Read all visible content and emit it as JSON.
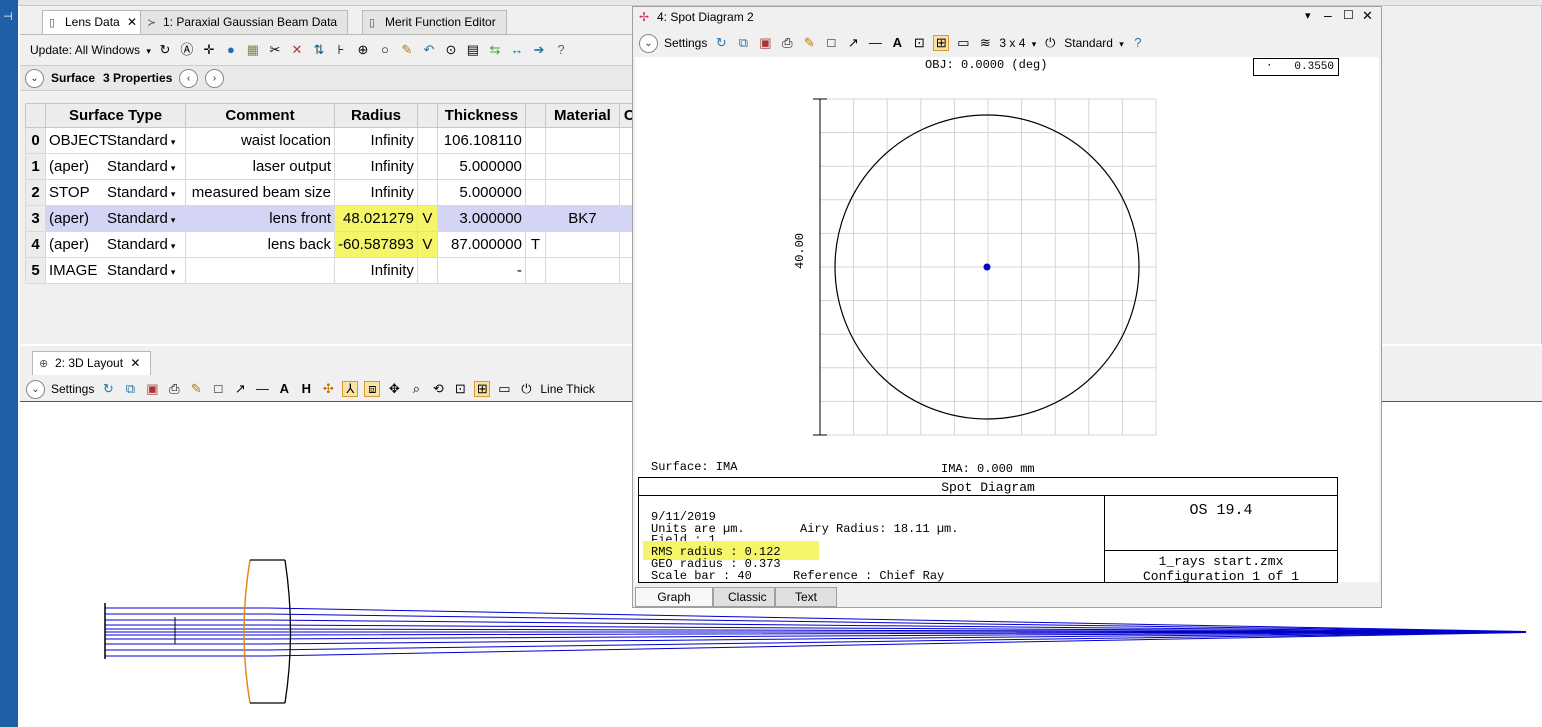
{
  "lens_editor": {
    "tabs": [
      {
        "label": "Lens Data",
        "icon": "document-icon"
      },
      {
        "label": "1: Paraxial Gaussian Beam Data",
        "icon": "beam-icon"
      },
      {
        "label": "Merit Function Editor",
        "icon": "document-icon"
      }
    ],
    "update_label": "Update: All Windows",
    "surface_label": "Surface",
    "properties_label": "3 Properties",
    "columns": [
      "Surface Type",
      "Comment",
      "Radius",
      "Thickness",
      "Material",
      "C"
    ],
    "rows": [
      {
        "index": "0",
        "name": "OBJECT",
        "type": "Standard",
        "comment": "waist location",
        "radius": "Infinity",
        "radius_flag": "",
        "thickness": "106.108110",
        "thickness_flag": "",
        "material": ""
      },
      {
        "index": "1",
        "name": "(aper)",
        "type": "Standard",
        "comment": "laser output",
        "radius": "Infinity",
        "radius_flag": "",
        "thickness": "5.000000",
        "thickness_flag": "",
        "material": ""
      },
      {
        "index": "2",
        "name": "STOP",
        "type": "Standard",
        "comment": "measured beam size",
        "radius": "Infinity",
        "radius_flag": "",
        "thickness": "5.000000",
        "thickness_flag": "",
        "material": ""
      },
      {
        "index": "3",
        "name": "(aper)",
        "type": "Standard",
        "comment": "lens front",
        "radius": "48.021279",
        "radius_flag": "V",
        "thickness": "3.000000",
        "thickness_flag": "",
        "material": "BK7"
      },
      {
        "index": "4",
        "name": "(aper)",
        "type": "Standard",
        "comment": "lens back",
        "radius": "-60.587893",
        "radius_flag": "V",
        "thickness": "87.000000",
        "thickness_flag": "T",
        "material": ""
      },
      {
        "index": "5",
        "name": "IMAGE",
        "type": "Standard",
        "comment": "",
        "radius": "Infinity",
        "radius_flag": "",
        "thickness": "-",
        "thickness_flag": "",
        "material": ""
      }
    ]
  },
  "layout_window": {
    "tab_label": "2: 3D Layout",
    "settings_label": "Settings",
    "line_thickness_label": "Line Thick"
  },
  "spot_window": {
    "title": "4: Spot Diagram 2",
    "settings_label": "Settings",
    "grid_label": "3 x 4",
    "mode_label": "Standard",
    "obj_label": "OBJ: 0.0000 (deg)",
    "scale_value": "0.3550",
    "axis_label": "40.00",
    "surface_label": "Surface: IMA",
    "ima_label": "IMA: 0.000 mm",
    "box_title": "Spot Diagram",
    "date": "9/11/2019",
    "units_line": "Units are µm.",
    "airy_line": "Airy Radius: 18.11 µm.",
    "field_line": "Field      :          1",
    "rms_line": "RMS radius :      0.122",
    "geo_line": "GEO radius :      0.373",
    "scalebar_line": "Scale bar  : 40",
    "reference_line": "Reference  : Chief Ray",
    "version": "OS 19.4",
    "filename": "1_rays start.zmx",
    "configuration": "Configuration 1 of 1",
    "bottom_tabs": [
      "Graph",
      "Classic",
      "Text"
    ]
  },
  "colors": {
    "ray": "#0000cc",
    "lens_edge": "#e08a1a",
    "highlight_yellow": "#f5f56a",
    "row_highlight": "#d4d4f4"
  }
}
